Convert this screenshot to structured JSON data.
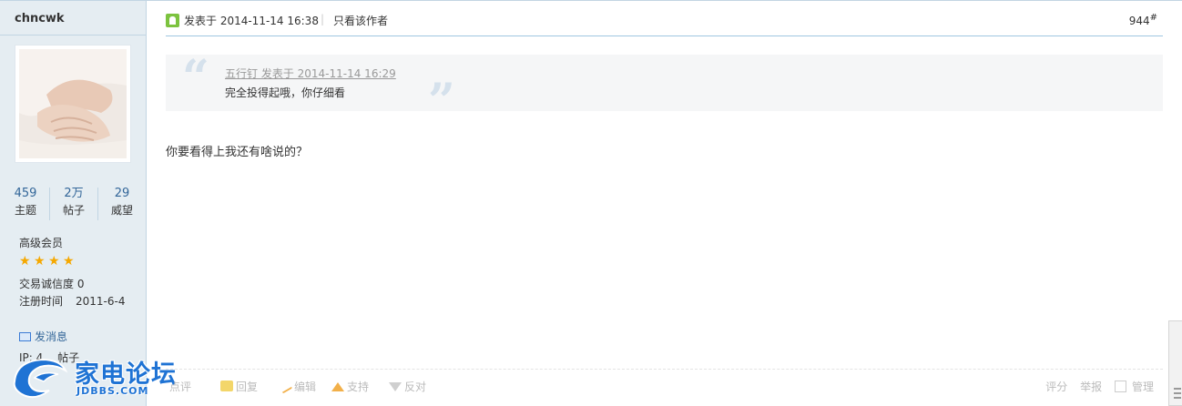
{
  "user": {
    "name": "chncwk",
    "stats": [
      {
        "num": "459",
        "label": "主题"
      },
      {
        "num": "2万",
        "label": "帖子"
      },
      {
        "num": "29",
        "label": "威望"
      }
    ],
    "group": "高级会员",
    "stars": 4,
    "credit_label": "交易诚信度 0",
    "reg_label": "注册时间",
    "reg_value": "2011-6-4",
    "send_message": "发消息",
    "ip_line": "IP: 4… 帖子"
  },
  "post": {
    "time": "发表于 2014-11-14 16:38",
    "separator": "|",
    "only_author": "只看该作者",
    "floor": "944",
    "floor_sup": "#",
    "quote": {
      "meta": "五行钉 发表于 2014-11-14 16:29",
      "text": "完全投得起哦，你仔细看"
    },
    "body": "你要看得上我还有啥说的？"
  },
  "actions": {
    "rate": "点评",
    "reply": "回复",
    "edit": "编辑",
    "support": "支持",
    "oppose": "反对",
    "score": "评分",
    "report": "举报",
    "manage": "管理"
  },
  "logo": {
    "cn": "家电论坛",
    "en": "JDBBS.COM"
  },
  "colors": {
    "side_bg": "#e5edf2",
    "border": "#c2d5e3",
    "link": "#336699",
    "logo": "#1f73d4"
  }
}
